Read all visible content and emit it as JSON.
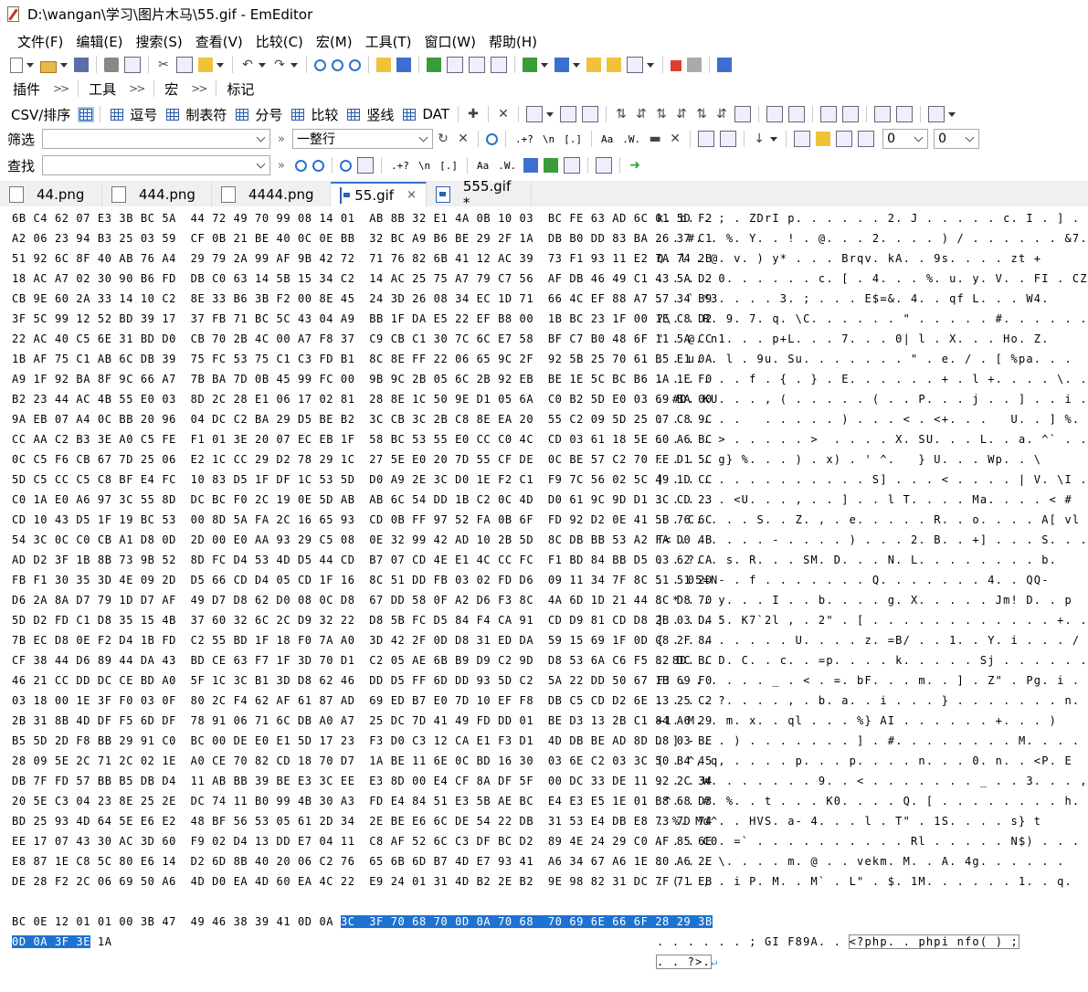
{
  "window": {
    "title": "D:\\wangan\\学习\\图片木马\\55.gif - EmEditor"
  },
  "menu": [
    "文件(F)",
    "编辑(E)",
    "搜索(S)",
    "查看(V)",
    "比较(C)",
    "宏(M)",
    "工具(T)",
    "窗口(W)",
    "帮助(H)"
  ],
  "toolbars": {
    "groups": [
      "插件",
      "工具",
      "宏",
      "标记"
    ],
    "csv": {
      "label": "CSV/排序",
      "items": [
        "逗号",
        "制表符",
        "分号",
        "比较",
        "竖线",
        "DAT"
      ]
    },
    "filter": {
      "label": "筛选",
      "value": "",
      "scope": "一整行",
      "col_a": "0",
      "col_b": "0"
    },
    "find": {
      "label": "查找",
      "value": ""
    }
  },
  "tabs": [
    {
      "label": "44.png",
      "active": false,
      "type": "png"
    },
    {
      "label": "444.png",
      "active": false,
      "type": "png"
    },
    {
      "label": "4444.png",
      "active": false,
      "type": "png"
    },
    {
      "label": "55.gif",
      "active": true,
      "type": "gif",
      "close": "×"
    },
    {
      "label": "555.gif *",
      "active": false,
      "type": "gif"
    }
  ],
  "hex_rows": [
    {
      "hex": "6B C4 62 07 E3 3B BC 5A  44 72 49 70 99 08 14 01  AB 8B 32 E1 4A 0B 10 03  BC FE 63 AD 6C 01 5D F2",
      "ascii": "k. b. . ; . ZDrI p. . . . . . 2. J . . . . . c. I . ] ."
    },
    {
      "hex": "A2 06 23 94 B3 25 03 59  CF 0B 21 BE 40 0C 0E BB  32 BC A9 B6 BE 29 2F 1A  DB B0 DD 83 BA 26 37 C1",
      "ascii": ". . #. . %. Y. . ! . @. . . 2. . . . ) / . . . . . . &7."
    },
    {
      "hex": "51 92 6C 8F 40 AB 76 A4  29 79 2A 99 AF 9B 42 72  71 76 82 6B 41 12 AC 39  73 F1 93 11 E2 7A 74 2B",
      "ascii": "Q. l . @. v. ) y* . . . Brqv. kA. . 9s. . . . zt +"
    },
    {
      "hex": "18 AC A7 02 30 90 B6 FD  DB C0 63 14 5B 15 34 C2  14 AC 25 75 A7 79 C7 56  AF DB 46 49 C1 43 5A D2",
      "ascii": ". . . . 0. . . . . . c. [ . 4. . . %. u. y. V. . FI . CZ."
    },
    {
      "hex": "CB 9E 60 2A 33 14 10 C2  8E 33 B6 3B F2 00 8E 45  24 3D 26 08 34 EC 1D 71  66 4C EF 88 A7 57 34 B9",
      "ascii": ". . ` *3. . . . 3. ; . . . E$=&. 4. . qf L. . . W4."
    },
    {
      "hex": "3F 5C 99 12 52 BD 39 17  37 FB 71 BC 5C 43 04 A9  BB 1F DA E5 22 EF B8 00  1B BC 23 1F 00 1E C8 D2",
      "ascii": "?\\. . R. 9. 7. q. \\C. . . . . . \" . . . . . #. . . . . . ."
    },
    {
      "hex": "22 AC 40 C5 6E 31 BD D0  CB 70 2B 4C 00 A7 F8 37  C9 CB C1 30 7C 6C E7 58  BF C7 B0 48 6F 11 5A CC",
      "ascii": "\" . @. n1. . . p+L. . . 7. . . 0| l . X. . . Ho. Z."
    },
    {
      "hex": "1B AF 75 C1 AB 6C DB 39  75 FC 53 75 C1 C3 FD B1  8C 8E FF 22 06 65 9C 2F  92 5B 25 70 61 B5 E1 0A",
      "ascii": ". . u. . l . 9u. Su. . . . . . . \" . e. / . [ %pa. . ."
    },
    {
      "hex": "A9 1F 92 BA 8F 9C 66 A7  7B BA 7D 0B 45 99 FC 00  9B 9C 2B 05 6C 2B 92 EB  BE 1E 5C BC B6 1A 1E F0",
      "ascii": ". . . . . . f . { . } . E. . . . . . + . l +. . . . \\. . . . ."
    },
    {
      "hex": "B2 23 44 AC 4B 55 E0 03  8D 2C 28 E1 06 17 02 81  28 8E 1C 50 9E D1 05 6A  C0 B2 5D E0 03 69 BA 00",
      "ascii": ". #D. KU. . . , ( . . . . . ( . . P. . . j . . ] . . i . ."
    },
    {
      "hex": "9A EB 07 A4 0C BB 20 96  04 DC C2 BA 29 D5 BE B2  3C CB 3C 2B C8 8E EA 20  55 C2 09 5D 25 07 C8 9C",
      "ascii": ". . . . . .   . . . . . ) . . . < . <+. . .   U. . ] %. . ."
    },
    {
      "hex": "CC AA C2 B3 3E A0 C5 FE  F1 01 3E 20 07 EC EB 1F  58 BC 53 55 E0 CC C0 4C  CD 03 61 18 5E 60 A6 BC",
      "ascii": ". . . . > . . . . . >  . . . . X. SU. . . L. . a. ^` . ."
    },
    {
      "hex": "0C C5 F6 CB 67 7D 25 06  E2 1C CC 29 D2 78 29 1C  27 5E E0 20 7D 55 CF DE  0C BE 57 C2 70 FE D1 5C",
      "ascii": ". . . . g} %. . . ) . x) . ' ^.   } U. . . Wp. . \\"
    },
    {
      "hex": "5D C5 CC C5 C8 BF E4 FC  10 83 D5 1F DF 1C 53 5D  D0 A9 2E 3C D0 1E F2 C1  F9 7C 56 02 5C 49 1D CC",
      "ascii": "] . . . . . . . . . . . . . S] . . . < . . . . | V. \\I . ."
    },
    {
      "hex": "C0 1A E0 A6 97 3C 55 8D  DC BC F0 2C 19 0E 5D AB  AB 6C 54 DD 1B C2 0C 4D  D0 61 9C 9D D1 3C CD 23",
      "ascii": ". . . . . <U. . . , . . ] . . l T. . . . Ma. . . . < #"
    },
    {
      "hex": "CD 10 43 D5 1F 19 BC 53  00 8D 5A FA 2C 16 65 93  CD 0B FF 97 52 FA 0B 6F  FD 92 D2 0E 41 5B 76 6C",
      "ascii": ". . C. . . . S. . Z. , . e. . . . . R. . o. . . . A[ vl"
    },
    {
      "hex": "54 3C 0C C0 CB A1 D8 0D  2D 00 E0 AA 93 29 C5 08  0E 32 99 42 AD 10 2B 5D  8C DB BB 53 A2 FA D0 4B",
      "ascii": "T< . . . . . . - . . . . ) . . . 2. B. . +] . . . S. . . K"
    },
    {
      "hex": "AD D2 3F 1B 8B 73 9B 52  8D FC D4 53 4D D5 44 CD  B7 07 CD 4E E1 4C CC FC  F1 BD 84 BB D5 03 62 CA",
      "ascii": ". . ?. . s. R. . . SM. D. . . N. L. . . . . . . . b."
    },
    {
      "hex": "FB F1 30 35 3D 4E 09 2D  D5 66 CD D4 05 CD 1F 16  8C 51 DD FB 03 02 FD D6  09 11 34 7F 8C 51 51 2D",
      "ascii": ". . 05=N- . f . . . . . . . Q. . . . . . . 4. . QQ-"
    },
    {
      "hex": "D6 2A 8A D7 79 1D D7 AF  49 D7 D8 62 D0 08 0C D8  67 DD 58 0F A2 D6 F3 8C  4A 6D 1D 21 44 8C D8 70",
      "ascii": ". * . . y. . . I . . b. . . . g. X. . . . . Jm! D. . p"
    },
    {
      "hex": "5D D2 FD C1 D8 35 15 4B  37 60 32 6C 2C D9 32 22  D8 5B FC D5 84 F4 CA 91  CD D9 81 CD D8 2B 03 D4",
      "ascii": "] . . . 5. K7`2l , . 2\" . [ . . . . . . . . . . . . +. ."
    },
    {
      "hex": "7B EC D8 0E F2 D4 1B FD  C2 55 BD 1F 18 F0 7A A0  3D 42 2F 0D D8 31 ED DA  59 15 69 1F 0D C8 2F 84",
      "ascii": "{ . . . . . . . . U. . . . z. =B/ . . 1. . Y. i . . . / ."
    },
    {
      "hex": "CF 38 44 D6 89 44 DA 43  BD CE 63 F7 1F 3D 70 D1  C2 05 AE 6B B9 D9 C2 9D  D8 53 6A C6 F5 82 DC BC",
      "ascii": ". 8D. . D. C. . c. . =p. . . . k. . . . . Sj . . . . . ."
    },
    {
      "hex": "46 21 CC DD DC CE BD A0  5F 1C 3C B1 3D D8 62 46  DD D5 FF 6D DD 93 5D C2  5A 22 DD 50 67 1B 69 F0",
      "ascii": "F! . . . . . . _ . < . =. bF. . . m. . ] . Z\" . Pg. i ."
    },
    {
      "hex": "03 18 00 1E 3F F0 03 0F  80 2C F4 62 AF 61 87 AD  69 ED B7 E0 7D 10 EF F8  DB C5 CD D2 6E 13 25 C2",
      "ascii": ". . . . ?. . . . , . b. a. . i . . . } . . . . . . . n. %"
    },
    {
      "hex": "2B 31 8B 4D DF F5 6D DF  78 91 06 71 6C DB A0 A7  25 DC 7D 41 49 FD DD 01  BE D3 13 2B C1 84 A6 29",
      "ascii": "+1. M. . m. x. . ql . . . %} AI . . . . . . +. . . )"
    },
    {
      "hex": "B5 5D 2D F8 BB 29 91 C0  BC 00 DE E0 E1 5D 17 23  F3 D0 C3 12 CA E1 F3 D1  4D DB BE AD 8D D8 03 BE",
      "ascii": ". ] - . . ) . . . . . . . ] . #. . . . . . . . M. . . . . . ."
    },
    {
      "hex": "28 09 5E 2C 71 2C 02 1E  A0 CE 70 82 CD 18 70 D7  1A BE 11 6E 0C BD 16 30  03 6E C2 03 3C 50 B4 45",
      "ascii": "( . ^, q, . . . . p. . . p. . . . n. . . 0. n. . <P. E"
    },
    {
      "hex": "DB 7F FD 57 BB B5 DB D4  11 AB BB 39 BE E3 3C EE  E3 8D 00 E4 CF 8A DF 5F  00 DC 33 DE 11 92 2C 34",
      "ascii": ". . . W. . . . . . . 9. . < . . . . . . . _ . . 3. . . , 4"
    },
    {
      "hex": "20 5E C3 04 23 8E 25 2E  DC 74 11 B0 99 4B 30 A3  FD E4 84 51 E3 5B AE BC  E4 E3 E5 1E 01 B8 68 D3",
      "ascii": " ^. . #. %. . t . . . K0. . . . Q. [ . . . . . . . . h."
    },
    {
      "hex": "BD 25 93 4D 64 5E E6 E2  48 BF 56 53 05 61 2D 34  2E BE E6 6C DE 54 22 DB  31 53 E4 DB E8 73 7D 74",
      "ascii": ". %. Md^. . HVS. a- 4. . . l . T\" . 1S. . . . s} t"
    },
    {
      "hex": "EE 17 07 43 30 AC 3D 60  F9 02 D4 13 DD E7 04 11  C8 AF 52 6C C3 DF BC D2  89 4E 24 29 C0 AF 85 6E",
      "ascii": ". . . C0. =` . . . . . . . . . . Rl . . . . . N$) . . . n"
    },
    {
      "hex": "E8 87 1E C8 5C 80 E6 14  D2 6D 8B 40 20 06 C2 76  65 6B 6D B7 4D E7 93 41  A6 34 67 A6 1E 80 A6 2E",
      "ascii": ". . . . \\. . . . m. @ . . vekm. M. . A. 4g. . . . . ."
    },
    {
      "hex": "DE 28 F2 2C 06 69 50 A6  4D D0 EA 4D 60 EA 4C 22  E9 24 01 31 4D B2 2E B2  9E 98 82 31 DC 7F 71 EB",
      "ascii": ". ( . , . i P. M. . M` . L\" . $. 1M. . . . . . 1. . q."
    }
  ],
  "last_row": {
    "hex_plain": "BC 0E 12 01 01 00 3B 47  49 46 38 39 41 0D 0A ",
    "hex_selected": "3C  3F 70 68 70 0D 0A 70 68  70 69 6E 66 6F 28 29 3B",
    "ascii_plain": ". . . . . . ; GI F89A. . ",
    "ascii_selected": "<?php. . phpi nfo( ) ;"
  },
  "final_row": {
    "hex_selected": "0D 0A 3F 3E",
    "hex_plain": " 1A",
    "ascii": ". . ?>.",
    "return_glyph": "↵"
  }
}
